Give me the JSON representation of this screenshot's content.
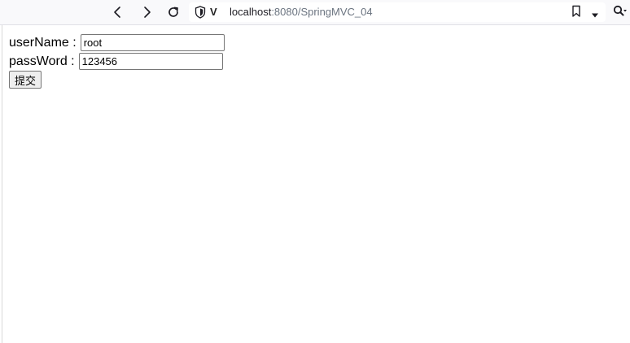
{
  "browser": {
    "url_host": "localhost",
    "url_rest": ":8080/SpringMVC_04",
    "icons": {
      "back": "arrow-left-icon",
      "forward": "arrow-right-icon",
      "reload": "reload-icon",
      "shield": "shield-icon",
      "vivaldi": "vivaldi-logo-icon",
      "bookmark": "bookmark-icon",
      "dropdown": "chevron-down-icon",
      "search": "search-icon"
    }
  },
  "form": {
    "username_label": "userName :",
    "username_value": "root",
    "password_label": "passWord :",
    "password_value": "123456",
    "submit_label": "提交"
  }
}
